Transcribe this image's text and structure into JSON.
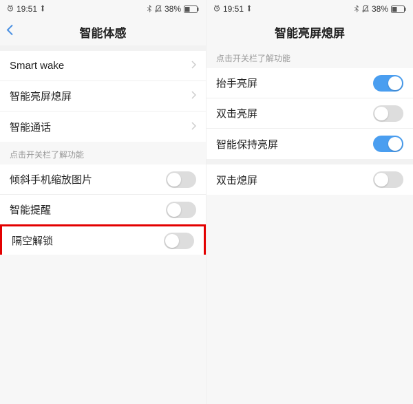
{
  "status": {
    "time": "19:51",
    "battery": "38%",
    "bt_icon": "bt-icon",
    "dnd_icon": "dnd-icon",
    "batt_icon": "battery-icon",
    "alarm_icon": "alarm-icon",
    "net_icon": "net-icon"
  },
  "left": {
    "title": "智能体感",
    "section1": [
      {
        "label": "Smart wake"
      },
      {
        "label": "智能亮屏熄屏"
      },
      {
        "label": "智能通话"
      }
    ],
    "section2_header": "点击开关栏了解功能",
    "section2": [
      {
        "label": "倾斜手机缩放图片",
        "on": false
      },
      {
        "label": "智能提醒",
        "on": false
      },
      {
        "label": "隔空解锁",
        "on": false,
        "highlight": true
      }
    ]
  },
  "right": {
    "title": "智能亮屏熄屏",
    "section1_header": "点击开关栏了解功能",
    "section1": [
      {
        "label": "抬手亮屏",
        "on": true
      },
      {
        "label": "双击亮屏",
        "on": false
      },
      {
        "label": "智能保持亮屏",
        "on": true
      }
    ],
    "section2": [
      {
        "label": "双击熄屏",
        "on": false
      }
    ]
  }
}
